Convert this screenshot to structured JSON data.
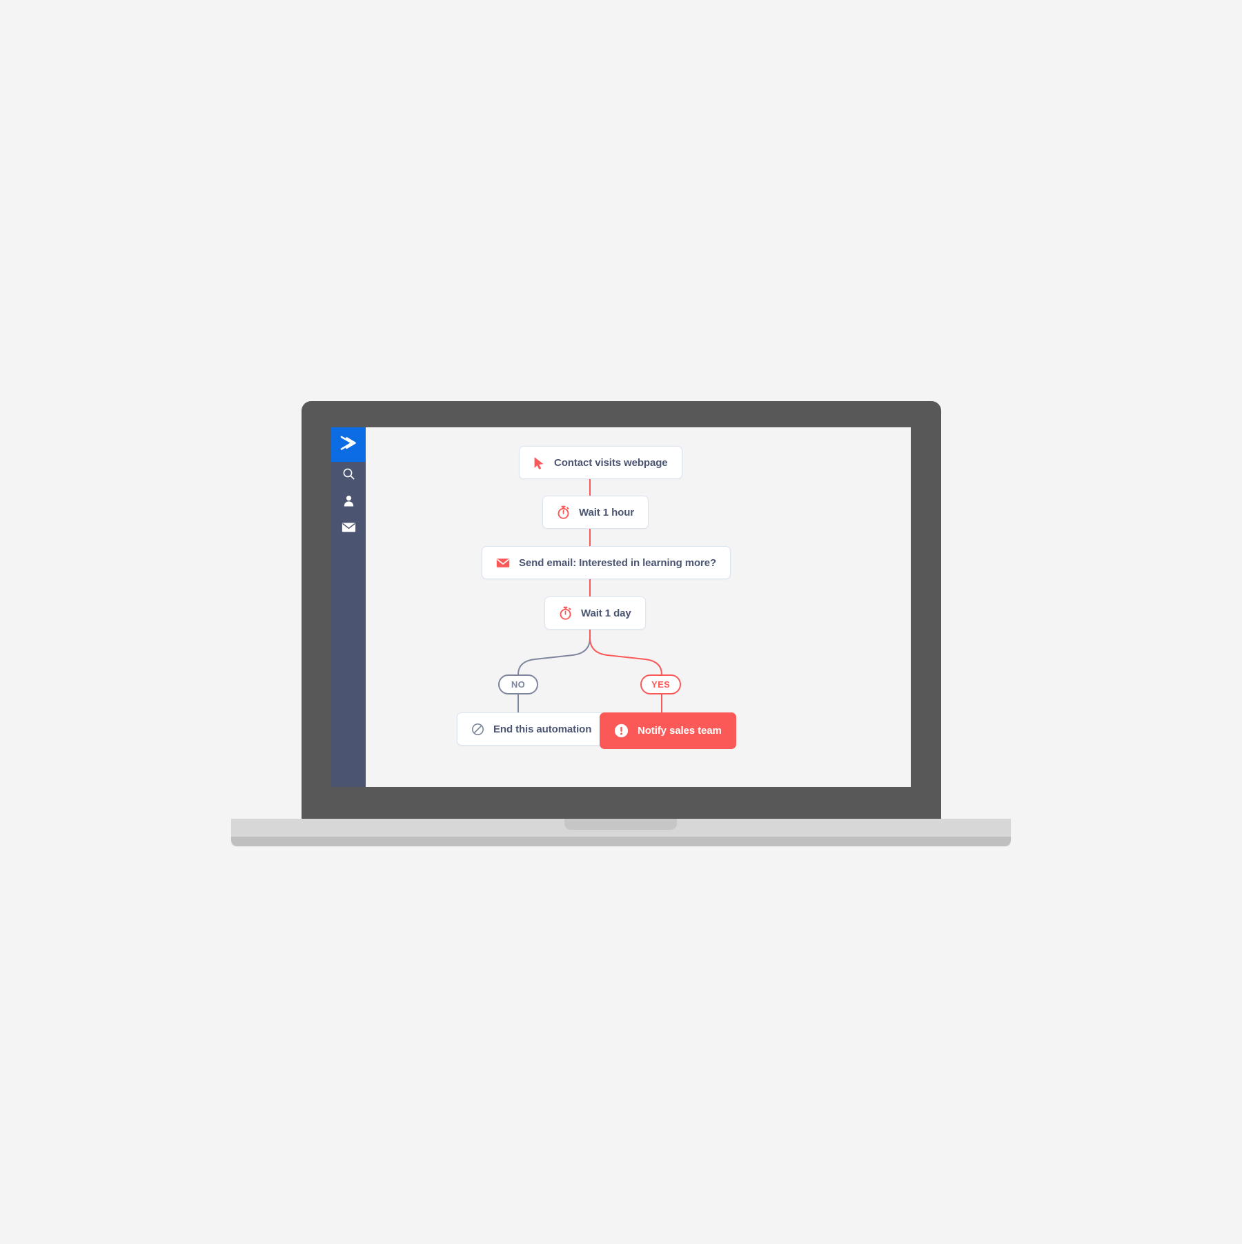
{
  "device": {
    "type": "laptop-mockup",
    "frame_color": "#585858",
    "base_color": "#d7d7d7",
    "page_background": "#f4f4f4"
  },
  "app": {
    "name": "ActiveCampaign",
    "accent_color": "#0b6ce4",
    "sidebar_color": "#4b5572",
    "canvas_color": "#f4f4f4",
    "text_color": "#4b5572",
    "danger_color": "#fb5858",
    "muted_color": "#7d869d",
    "border_color": "#dde4f1"
  },
  "sidebar": {
    "logo": {
      "icon": "chevron-logo-icon",
      "label": "ActiveCampaign"
    },
    "items": [
      {
        "icon": "search-icon",
        "label": "Search"
      },
      {
        "icon": "contact-person-icon",
        "label": "Contacts"
      },
      {
        "icon": "envelope-icon",
        "label": "Campaigns"
      }
    ]
  },
  "automation": {
    "title": "Automation builder",
    "nodes": [
      {
        "id": "trigger",
        "label": "Contact visits webpage",
        "icon": "cursor-arrow-icon",
        "style": "default",
        "icon_color": "#fb5858"
      },
      {
        "id": "wait-hour",
        "label": "Wait 1 hour",
        "icon": "stopwatch-icon",
        "style": "default",
        "icon_color": "#fb5858"
      },
      {
        "id": "send-email",
        "label": "Send email: Interested in learning more?",
        "icon": "envelope-icon",
        "style": "default",
        "icon_color": "#fb5858"
      },
      {
        "id": "wait-day",
        "label": "Wait 1 day",
        "icon": "stopwatch-icon",
        "style": "default",
        "icon_color": "#fb5858"
      },
      {
        "id": "end-automation",
        "label": "End this automation",
        "icon": "no-entry-circle-icon",
        "style": "default",
        "icon_color": "#7d869d"
      },
      {
        "id": "notify-sales",
        "label": "Notify sales team",
        "icon": "exclamation-circle-icon",
        "style": "alert",
        "icon_color": "#ffffff"
      }
    ],
    "branches": [
      {
        "id": "branch-no",
        "label": "NO",
        "color": "#7d869d"
      },
      {
        "id": "branch-yes",
        "label": "YES",
        "color": "#fb5858"
      }
    ]
  }
}
